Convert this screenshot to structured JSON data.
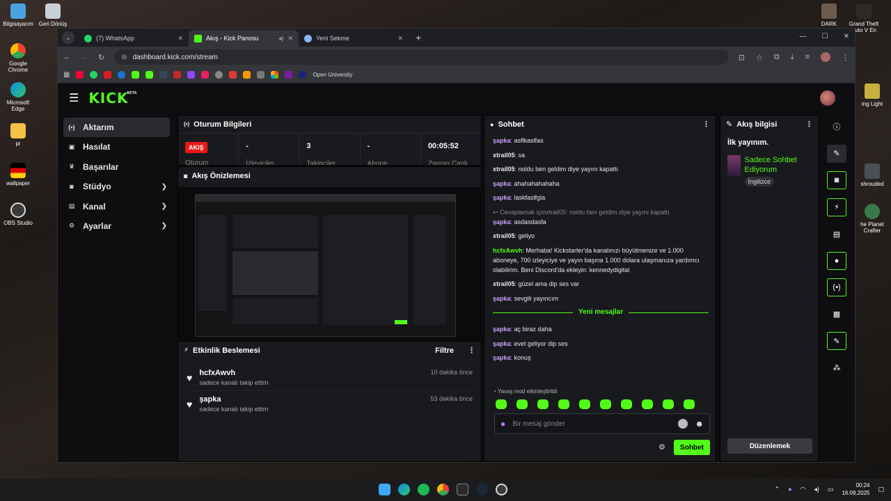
{
  "desktop": {
    "left_icons": [
      "Bilgisayarım",
      "Geri Dönüş",
      "Google Chrome",
      "Microsoft Edge",
      "pr",
      "wallpaper",
      "OBS Studio"
    ],
    "right_icons": [
      "DARK",
      "Grand Theft Auto V En",
      "ing Light",
      "shrouded",
      "he Planet Crafter"
    ]
  },
  "browser": {
    "tabs": [
      {
        "title": "(7) WhatsApp",
        "color": "#25d366"
      },
      {
        "title": "Akış - Kick Panosu",
        "color": "#53fc18"
      },
      {
        "title": "Yeni Sekme",
        "color": "#8ab4f8"
      }
    ],
    "url": "dashboard.kick.com/stream",
    "bookmark_label": "Open University"
  },
  "nav": {
    "logo": "KICK",
    "beta": "BETA",
    "items": [
      {
        "label": "Aktarım",
        "icon": "(•)"
      },
      {
        "label": "Hasılat",
        "icon": "▣"
      },
      {
        "label": "Başarılar",
        "icon": "♛"
      },
      {
        "label": "Stüdyo",
        "icon": "◙"
      },
      {
        "label": "Kanal",
        "icon": "▤"
      },
      {
        "label": "Ayarlar",
        "icon": "⚙"
      }
    ]
  },
  "session": {
    "title": "Oturum Bilgileri",
    "live": "AKIŞ",
    "live_label": "Oturum",
    "stats": [
      {
        "value": "-",
        "label": "İzleyiciler"
      },
      {
        "value": "3",
        "label": "Takipçiler"
      },
      {
        "value": "-",
        "label": "Abone"
      },
      {
        "value": "00:05:52",
        "label": "Zaman Canlı"
      }
    ]
  },
  "preview": {
    "title": "Akış Önizlemesi"
  },
  "activity": {
    "title": "Etkinlik Beslemesi",
    "filter": "Filtre",
    "items": [
      {
        "name": "hcfxAwvh",
        "text": "sadece kanalı takip ettim",
        "time": "10 dakika önce"
      },
      {
        "name": "şapka",
        "text": "sadece kanalı takip ettim",
        "time": "53 dakika önce"
      }
    ]
  },
  "chat": {
    "title": "Sohbet",
    "messages": [
      {
        "user": "şapka",
        "text": "asflkaslfas",
        "color": "#c9a0ff"
      },
      {
        "user": "xtrail05",
        "text": "sa",
        "color": "#e8e8e8"
      },
      {
        "user": "xtrail05",
        "text": "noldu ben geldim diye yayını kapattı",
        "color": "#e8e8e8"
      },
      {
        "user": "şapka",
        "text": "ahahahahahaha",
        "color": "#c9a0ff"
      },
      {
        "user": "şapka",
        "text": "laskfaslfgla",
        "color": "#c9a0ff"
      },
      {
        "reply": "Cevaplamak içinxtrail05: noldu ben geldim diye yayını kapattı",
        "user": "şapka",
        "text": "asdasdasfa",
        "color": "#c9a0ff"
      },
      {
        "user": "xtrail05",
        "text": "geliyo",
        "color": "#e8e8e8"
      },
      {
        "user": "hcfxAwvh",
        "text": "Merhaba! Kickstarter'da kanalınızı büyütmenize ve 1.000 aboneye, 700 izleyiciye ve yayın başına 1.000 dolara ulaşmanıza yardımcı olabilirim. Beni Discord'da ekleyin: kennedydigital",
        "color": "#53fc18"
      },
      {
        "user": "xtrail05",
        "text": "güzel ama dip ses var",
        "color": "#e8e8e8"
      },
      {
        "user": "şapka",
        "text": "sevgili yayıncım",
        "color": "#c9a0ff"
      }
    ],
    "new_label": "Yeni mesajlar",
    "new_messages": [
      {
        "user": "şapka",
        "text": "aç biraz daha",
        "color": "#c9a0ff"
      },
      {
        "user": "şapka",
        "text": "evet geliyor dip ses",
        "color": "#c9a0ff"
      },
      {
        "user": "şapka",
        "text": "konuş",
        "color": "#c9a0ff"
      }
    ],
    "slow_mode": "Yavaş mod etkinleştirildi",
    "placeholder": "Bir mesaj gönder",
    "send": "Sohbet"
  },
  "info": {
    "title": "Akış bilgisi",
    "stream_title": "İlk yayınım.",
    "category": "Sadece Sohbet Ediyorum",
    "tag": "İngilizce",
    "edit": "Düzenlemek"
  },
  "taskbar": {
    "time": "00:24",
    "date": "16.09.2025"
  }
}
